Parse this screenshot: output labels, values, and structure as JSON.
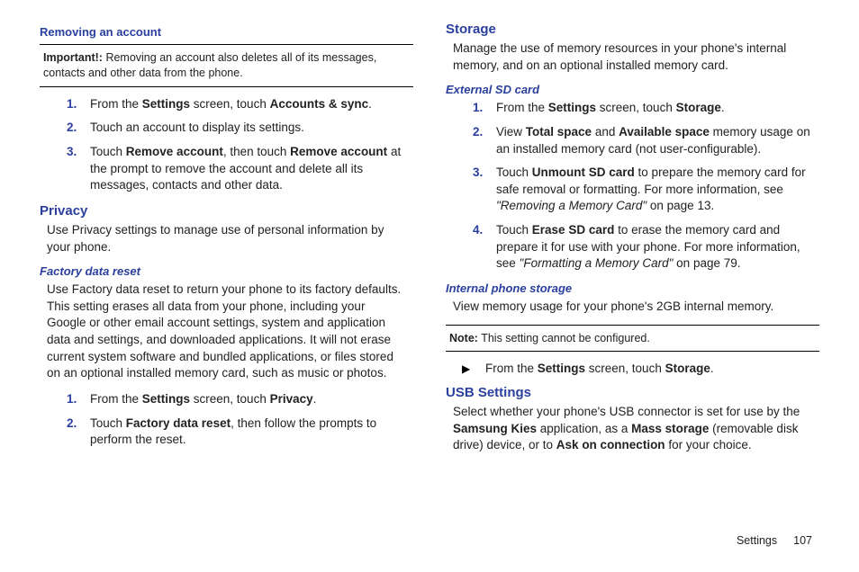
{
  "col1": {
    "removing_heading": "Removing an account",
    "important_lead": "Important!:",
    "important_body": " Removing an account also deletes all of its messages, contacts and other data from the phone.",
    "step1_a": "From the ",
    "step1_b": "Settings",
    "step1_c": " screen, touch ",
    "step1_d": "Accounts & sync",
    "step1_e": ".",
    "step2": "Touch an account to display its settings.",
    "step3_a": "Touch ",
    "step3_b": "Remove account",
    "step3_c": ", then touch ",
    "step3_d": "Remove account",
    "step3_e": " at the prompt to remove the account and delete all its messages, contacts and other data.",
    "privacy_heading": "Privacy",
    "privacy_para": "Use Privacy settings to manage use of personal information by your phone.",
    "factory_heading": "Factory data reset",
    "factory_para": "Use Factory data reset to return your phone to its factory defaults. This setting erases all data from your phone, including your Google or other email account settings, system and application data and settings, and downloaded applications.  It will not erase current system software and bundled applications, or files stored on an optional installed memory card, such as music or photos.",
    "fstep1_a": "From the ",
    "fstep1_b": "Settings",
    "fstep1_c": " screen, touch ",
    "fstep1_d": "Privacy",
    "fstep1_e": ".",
    "fstep2_a": "Touch ",
    "fstep2_b": "Factory data reset",
    "fstep2_c": ", then follow the prompts to perform the reset."
  },
  "col2": {
    "storage_heading": "Storage",
    "storage_para": "Manage the use of memory resources in your phone's internal memory, and on an optional installed memory card.",
    "ext_heading": "External SD card",
    "es1_a": "From the ",
    "es1_b": "Settings",
    "es1_c": " screen, touch ",
    "es1_d": "Storage",
    "es1_e": ".",
    "es2_a": "View ",
    "es2_b": "Total space",
    "es2_c": " and ",
    "es2_d": "Available space",
    "es2_e": " memory usage on an installed memory card (not user-configurable).",
    "es3_a": "Touch ",
    "es3_b": "Unmount SD card",
    "es3_c": " to prepare the memory card for safe removal or formatting. For more information, see ",
    "es3_d": "\"Removing a Memory Card\"",
    "es3_e": " on page 13.",
    "es4_a": "Touch ",
    "es4_b": "Erase SD card",
    "es4_c": " to erase the memory card and prepare it for use with your phone. For more information, see ",
    "es4_d": "\"Formatting a Memory Card\"",
    "es4_e": " on page 79.",
    "int_heading": "Internal phone storage",
    "int_para": "View memory usage for your phone's 2GB internal memory.",
    "note_lead": "Note:",
    "note_body": " This setting cannot be configured.",
    "xref_a": "From the ",
    "xref_b": "Settings",
    "xref_c": " screen, touch ",
    "xref_d": "Storage",
    "xref_e": ".",
    "usb_heading": "USB Settings",
    "usb_a": "Select whether your phone's USB connector is set for use by the ",
    "usb_b": "Samsung Kies",
    "usb_c": " application, as a ",
    "usb_d": "Mass storage",
    "usb_e": " (removable disk drive) device, or to ",
    "usb_f": "Ask on connection",
    "usb_g": " for your choice."
  },
  "footer": {
    "label": "Settings",
    "page": "107"
  }
}
